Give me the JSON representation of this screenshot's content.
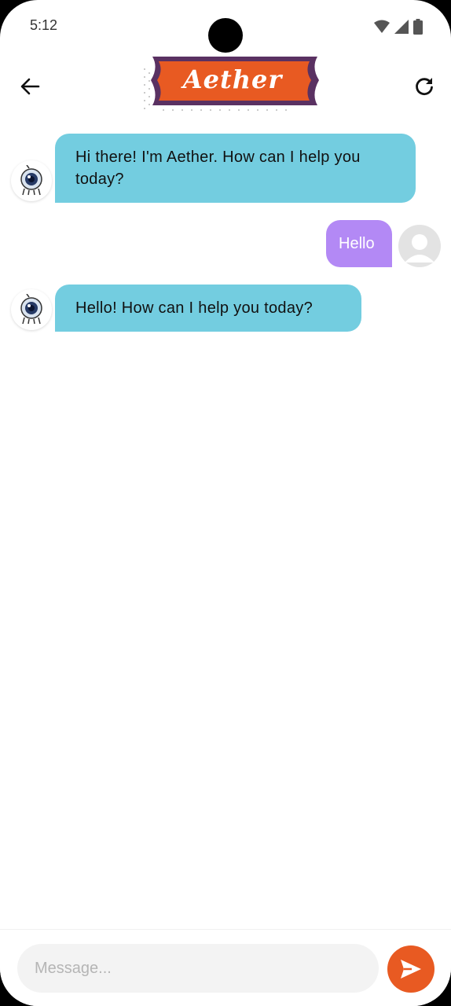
{
  "status_bar": {
    "time": "5:12"
  },
  "app_bar": {
    "title": "Aether",
    "back_icon": "arrow-left-icon",
    "refresh_icon": "refresh-icon",
    "logo_color": "#e85a22",
    "logo_border_color": "#5a3162"
  },
  "messages": [
    {
      "sender": "bot",
      "text": "Hi there! I'm Aether. How can I help you today?"
    },
    {
      "sender": "user",
      "text": "Hello"
    },
    {
      "sender": "bot",
      "text": "Hello! How can I help you today?"
    }
  ],
  "composer": {
    "placeholder": "Message...",
    "value": "",
    "send_icon": "send-icon"
  },
  "colors": {
    "bot_bubble": "#73cde0",
    "user_bubble": "#b389f5",
    "accent": "#e85a22"
  }
}
